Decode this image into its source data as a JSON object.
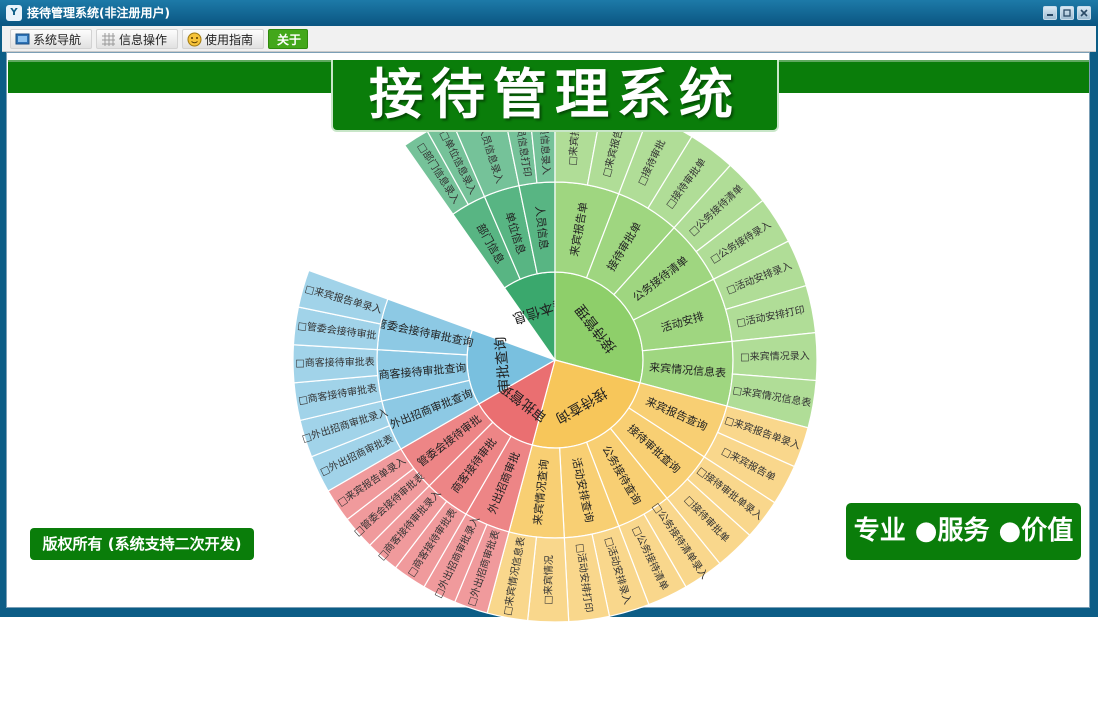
{
  "window": {
    "title": "接待管理系统(非注册用户)",
    "icon": "app-logo-icon"
  },
  "menu": [
    {
      "label": "系统导航",
      "icon": "monitor-icon"
    },
    {
      "label": "信息操作",
      "icon": "grid-icon"
    },
    {
      "label": "使用指南",
      "icon": "smiley-icon"
    },
    {
      "label": "关于",
      "icon": ""
    }
  ],
  "banner": {
    "title": "接待管理系统"
  },
  "copyright": "版权所有 (系统支持二次开发)",
  "slogan": "专业 ●服务 ●价值",
  "colors": {
    "brand_green": "#0a7d0a",
    "title_bar": "#0c5d86"
  },
  "chart_data": {
    "type": "sunburst",
    "center": "",
    "groups": [
      {
        "label": "基本信息",
        "color": "#3aa86d",
        "children": [
          {
            "label": "部门信息",
            "leaves": [
              "部门信息录入",
              "单位信息录入"
            ]
          },
          {
            "label": "单位信息",
            "leaves": [
              "人员信息录入"
            ]
          },
          {
            "label": "人员信息",
            "leaves": [
              "人员信息打印",
              "人员信息录入"
            ]
          }
        ]
      },
      {
        "label": "接待管理",
        "color": "#8ecf6a",
        "children": [
          {
            "label": "来宾报告单",
            "leaves": [
              "来宾报告",
              "来宾报告单"
            ]
          },
          {
            "label": "接待审批单",
            "leaves": [
              "接待审批",
              "接待审批单"
            ]
          },
          {
            "label": "公务接待清单",
            "leaves": [
              "公务接待清单",
              "公务接待录入"
            ]
          },
          {
            "label": "活动安排",
            "leaves": [
              "活动安排录入",
              "活动安排打印"
            ]
          },
          {
            "label": "来宾情况信息表",
            "leaves": [
              "来宾情况录入",
              "来宾情况信息表"
            ]
          }
        ]
      },
      {
        "label": "接待查询",
        "color": "#f7c65a",
        "children": [
          {
            "label": "来宾报告查询",
            "leaves": [
              "来宾报告单录入",
              "来宾报告单"
            ]
          },
          {
            "label": "接待审批查询",
            "leaves": [
              "接待审批单录入",
              "接待审批单"
            ]
          },
          {
            "label": "公务接待查询",
            "leaves": [
              "公务接待清单录入",
              "公务接待清单"
            ]
          },
          {
            "label": "活动安排查询",
            "leaves": [
              "活动安排录入",
              "活动安排打印"
            ]
          },
          {
            "label": "来宾情况查询",
            "leaves": [
              "来宾情况",
              "来宾情况信息表"
            ]
          }
        ]
      },
      {
        "label": "审批管理",
        "color": "#ea6f71",
        "children": [
          {
            "label": "外出招商审批",
            "leaves": [
              "外出招商审批表",
              "外出招商审批录入"
            ]
          },
          {
            "label": "商客接待审批",
            "leaves": [
              "商客接待审批表",
              "商客接待审批录入"
            ]
          },
          {
            "label": "管委会接待审批",
            "leaves": [
              "管委会接待审批表",
              "来宾报告单录入"
            ]
          }
        ]
      },
      {
        "label": "审批查询",
        "color": "#79c0df",
        "children": [
          {
            "label": "外出招商审批查询",
            "leaves": [
              "外出招商审批表",
              "外出招商审批录入"
            ]
          },
          {
            "label": "商客接待审批查询",
            "leaves": [
              "商客接待审批表",
              "商客接待审批表"
            ]
          },
          {
            "label": "管委会接待审批查询",
            "leaves": [
              "管委会接待审批",
              "来宾报告单录入"
            ]
          }
        ]
      }
    ]
  }
}
